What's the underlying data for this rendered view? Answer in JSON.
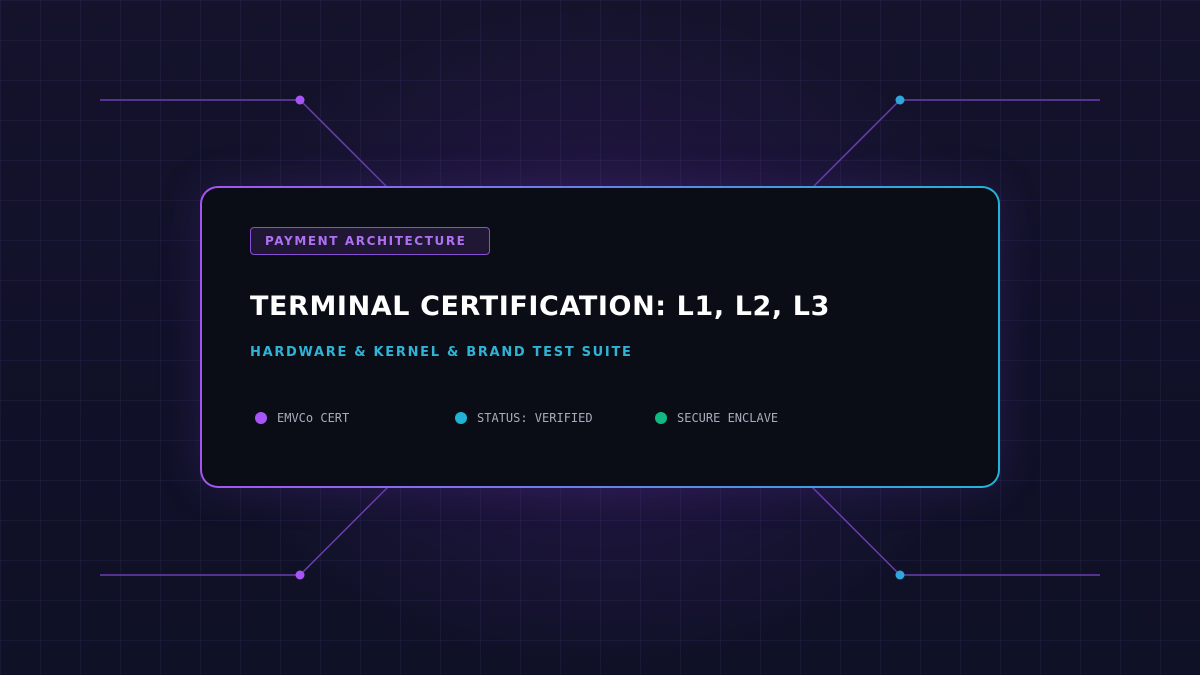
{
  "badge": {
    "label": "PAYMENT ARCHITECTURE"
  },
  "title": "TERMINAL CERTIFICATION: L1, L2, L3",
  "subtitle": "HARDWARE & KERNEL & BRAND TEST SUITE",
  "status_items": [
    {
      "label": "EMVCo CERT",
      "color": "#a855f7"
    },
    {
      "label": "STATUS: VERIFIED",
      "color": "#1fb3d6"
    },
    {
      "label": "SECURE ENCLAVE",
      "color": "#10b981"
    }
  ],
  "colors": {
    "accent_purple": "#a855f7",
    "accent_cyan": "#22b4d8",
    "accent_green": "#10b981",
    "card_background": "#0b0d16"
  }
}
